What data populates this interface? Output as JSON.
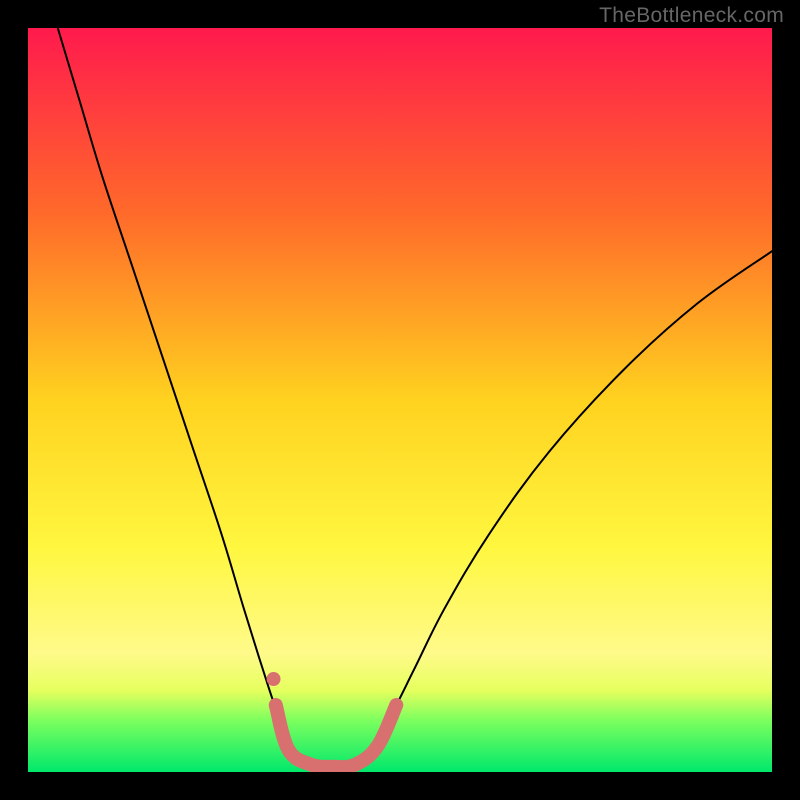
{
  "watermark": "TheBottleneck.com",
  "chart_data": {
    "type": "line",
    "title": "",
    "xlabel": "",
    "ylabel": "",
    "xlim": [
      0,
      100
    ],
    "ylim": [
      0,
      100
    ],
    "background_gradient": {
      "stops": [
        {
          "offset": 0,
          "color": "#ff1a4d"
        },
        {
          "offset": 25,
          "color": "#ff6a2a"
        },
        {
          "offset": 50,
          "color": "#ffd21f"
        },
        {
          "offset": 70,
          "color": "#fff740"
        },
        {
          "offset": 84,
          "color": "#fffa8a"
        },
        {
          "offset": 89,
          "color": "#e6ff5e"
        },
        {
          "offset": 93,
          "color": "#7dff5e"
        },
        {
          "offset": 100,
          "color": "#00e86b"
        }
      ]
    },
    "series": [
      {
        "name": "bottleneck-curve",
        "stroke": "#000000",
        "stroke_width": 2,
        "points": [
          {
            "x": 4.0,
            "y": 100.0
          },
          {
            "x": 7.0,
            "y": 90.0
          },
          {
            "x": 10.0,
            "y": 80.0
          },
          {
            "x": 14.0,
            "y": 68.0
          },
          {
            "x": 18.0,
            "y": 56.0
          },
          {
            "x": 22.0,
            "y": 44.0
          },
          {
            "x": 26.0,
            "y": 32.0
          },
          {
            "x": 29.0,
            "y": 22.0
          },
          {
            "x": 31.5,
            "y": 14.0
          },
          {
            "x": 33.5,
            "y": 8.0
          },
          {
            "x": 35.5,
            "y": 3.5
          },
          {
            "x": 38.0,
            "y": 1.2
          },
          {
            "x": 41.0,
            "y": 0.8
          },
          {
            "x": 44.0,
            "y": 1.2
          },
          {
            "x": 46.5,
            "y": 3.5
          },
          {
            "x": 49.0,
            "y": 8.0
          },
          {
            "x": 52.0,
            "y": 14.0
          },
          {
            "x": 56.0,
            "y": 22.0
          },
          {
            "x": 62.0,
            "y": 32.0
          },
          {
            "x": 70.0,
            "y": 43.0
          },
          {
            "x": 80.0,
            "y": 54.0
          },
          {
            "x": 90.0,
            "y": 63.0
          },
          {
            "x": 100.0,
            "y": 70.0
          }
        ]
      },
      {
        "name": "highlight-band",
        "stroke": "#d87070",
        "stroke_width": 14,
        "points": [
          {
            "x": 33.3,
            "y": 9.0
          },
          {
            "x": 35.0,
            "y": 3.0
          },
          {
            "x": 38.0,
            "y": 1.0
          },
          {
            "x": 41.0,
            "y": 0.7
          },
          {
            "x": 44.0,
            "y": 1.0
          },
          {
            "x": 47.0,
            "y": 3.5
          },
          {
            "x": 49.5,
            "y": 9.0
          }
        ]
      }
    ],
    "markers": [
      {
        "name": "highlight-dot",
        "x": 33.0,
        "y": 12.5,
        "r": 7,
        "fill": "#d87070"
      }
    ]
  }
}
